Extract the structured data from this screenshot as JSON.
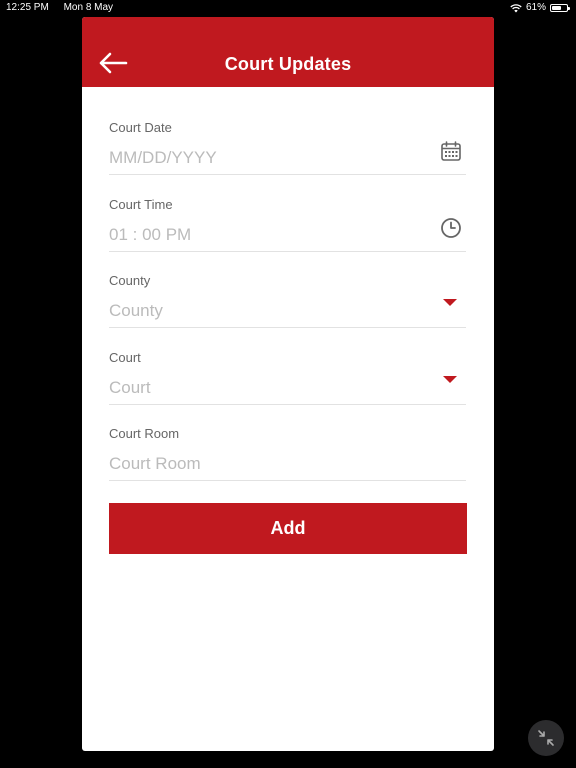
{
  "status_bar": {
    "time": "12:25 PM",
    "date": "Mon 8 May",
    "battery_text": "61%",
    "battery_level": 0.61,
    "wifi_icon": "wifi-icon"
  },
  "header": {
    "title": "Court Updates",
    "back_icon": "arrow-left-icon",
    "color": "#c0191f"
  },
  "form": {
    "court_date": {
      "label": "Court Date",
      "placeholder": "MM/DD/YYYY",
      "icon": "calendar-icon"
    },
    "court_time": {
      "label": "Court Time",
      "value": "01 : 00 PM",
      "icon": "clock-icon"
    },
    "county": {
      "label": "County",
      "placeholder": "County",
      "icon": "dropdown-arrow-icon"
    },
    "court": {
      "label": "Court",
      "placeholder": "Court",
      "icon": "dropdown-arrow-icon"
    },
    "court_room": {
      "label": "Court Room",
      "placeholder": "Court Room"
    }
  },
  "actions": {
    "add_label": "Add"
  },
  "overlay": {
    "minimize_icon": "collapse-arrows-icon"
  }
}
